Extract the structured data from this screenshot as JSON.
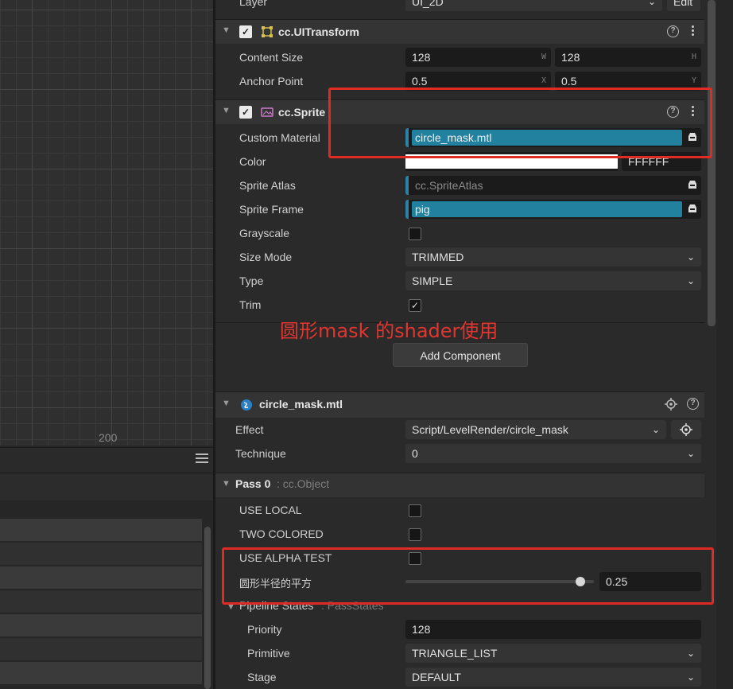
{
  "scene": {
    "label": "200"
  },
  "transform_component": {
    "layer_label": "Layer",
    "layer_value": "UI_2D",
    "layer_edit": "Edit",
    "title": "cc.UITransform",
    "content_size_label": "Content Size",
    "content_w": "128",
    "content_w_suffix": "W",
    "content_h": "128",
    "content_h_suffix": "H",
    "anchor_label": "Anchor Point",
    "anchor_x": "0.5",
    "anchor_x_suffix": "X",
    "anchor_y": "0.5",
    "anchor_y_suffix": "Y"
  },
  "sprite_component": {
    "title": "cc.Sprite",
    "custom_material_label": "Custom Material",
    "custom_material_value": "circle_mask.mtl",
    "color_label": "Color",
    "color_hex": "FFFFFF",
    "color_swatch": "#ffffff",
    "sprite_atlas_label": "Sprite Atlas",
    "sprite_atlas_value": "cc.SpriteAtlas",
    "sprite_frame_label": "Sprite Frame",
    "sprite_frame_value": "pig",
    "grayscale_label": "Grayscale",
    "grayscale_checked": false,
    "size_mode_label": "Size Mode",
    "size_mode_value": "TRIMMED",
    "type_label": "Type",
    "type_value": "SIMPLE",
    "trim_label": "Trim",
    "trim_checked": true
  },
  "annotation_text": "圆形mask 的shader使用",
  "add_component_label": "Add Component",
  "material_panel": {
    "title": "circle_mask.mtl",
    "effect_label": "Effect",
    "effect_value": "Script/LevelRender/circle_mask",
    "technique_label": "Technique",
    "technique_value": "0",
    "pass_title": "Pass 0",
    "pass_type": ": cc.Object",
    "use_local_label": "USE LOCAL",
    "two_colored_label": "TWO COLORED",
    "use_alpha_test_label": "USE ALPHA TEST",
    "radius_label": "圆形半径的平方",
    "radius_value": "0.25",
    "radius_fraction": 0.93,
    "pipeline_label": "Pipeline States",
    "pipeline_type": ": PassStates",
    "priority_label": "Priority",
    "priority_value": "128",
    "primitive_label": "Primitive",
    "primitive_value": "TRIANGLE_LIST",
    "stage_label": "Stage",
    "stage_value": "DEFAULT"
  },
  "colors": {
    "accent": "#22819f",
    "highlight": "#e02a24"
  }
}
